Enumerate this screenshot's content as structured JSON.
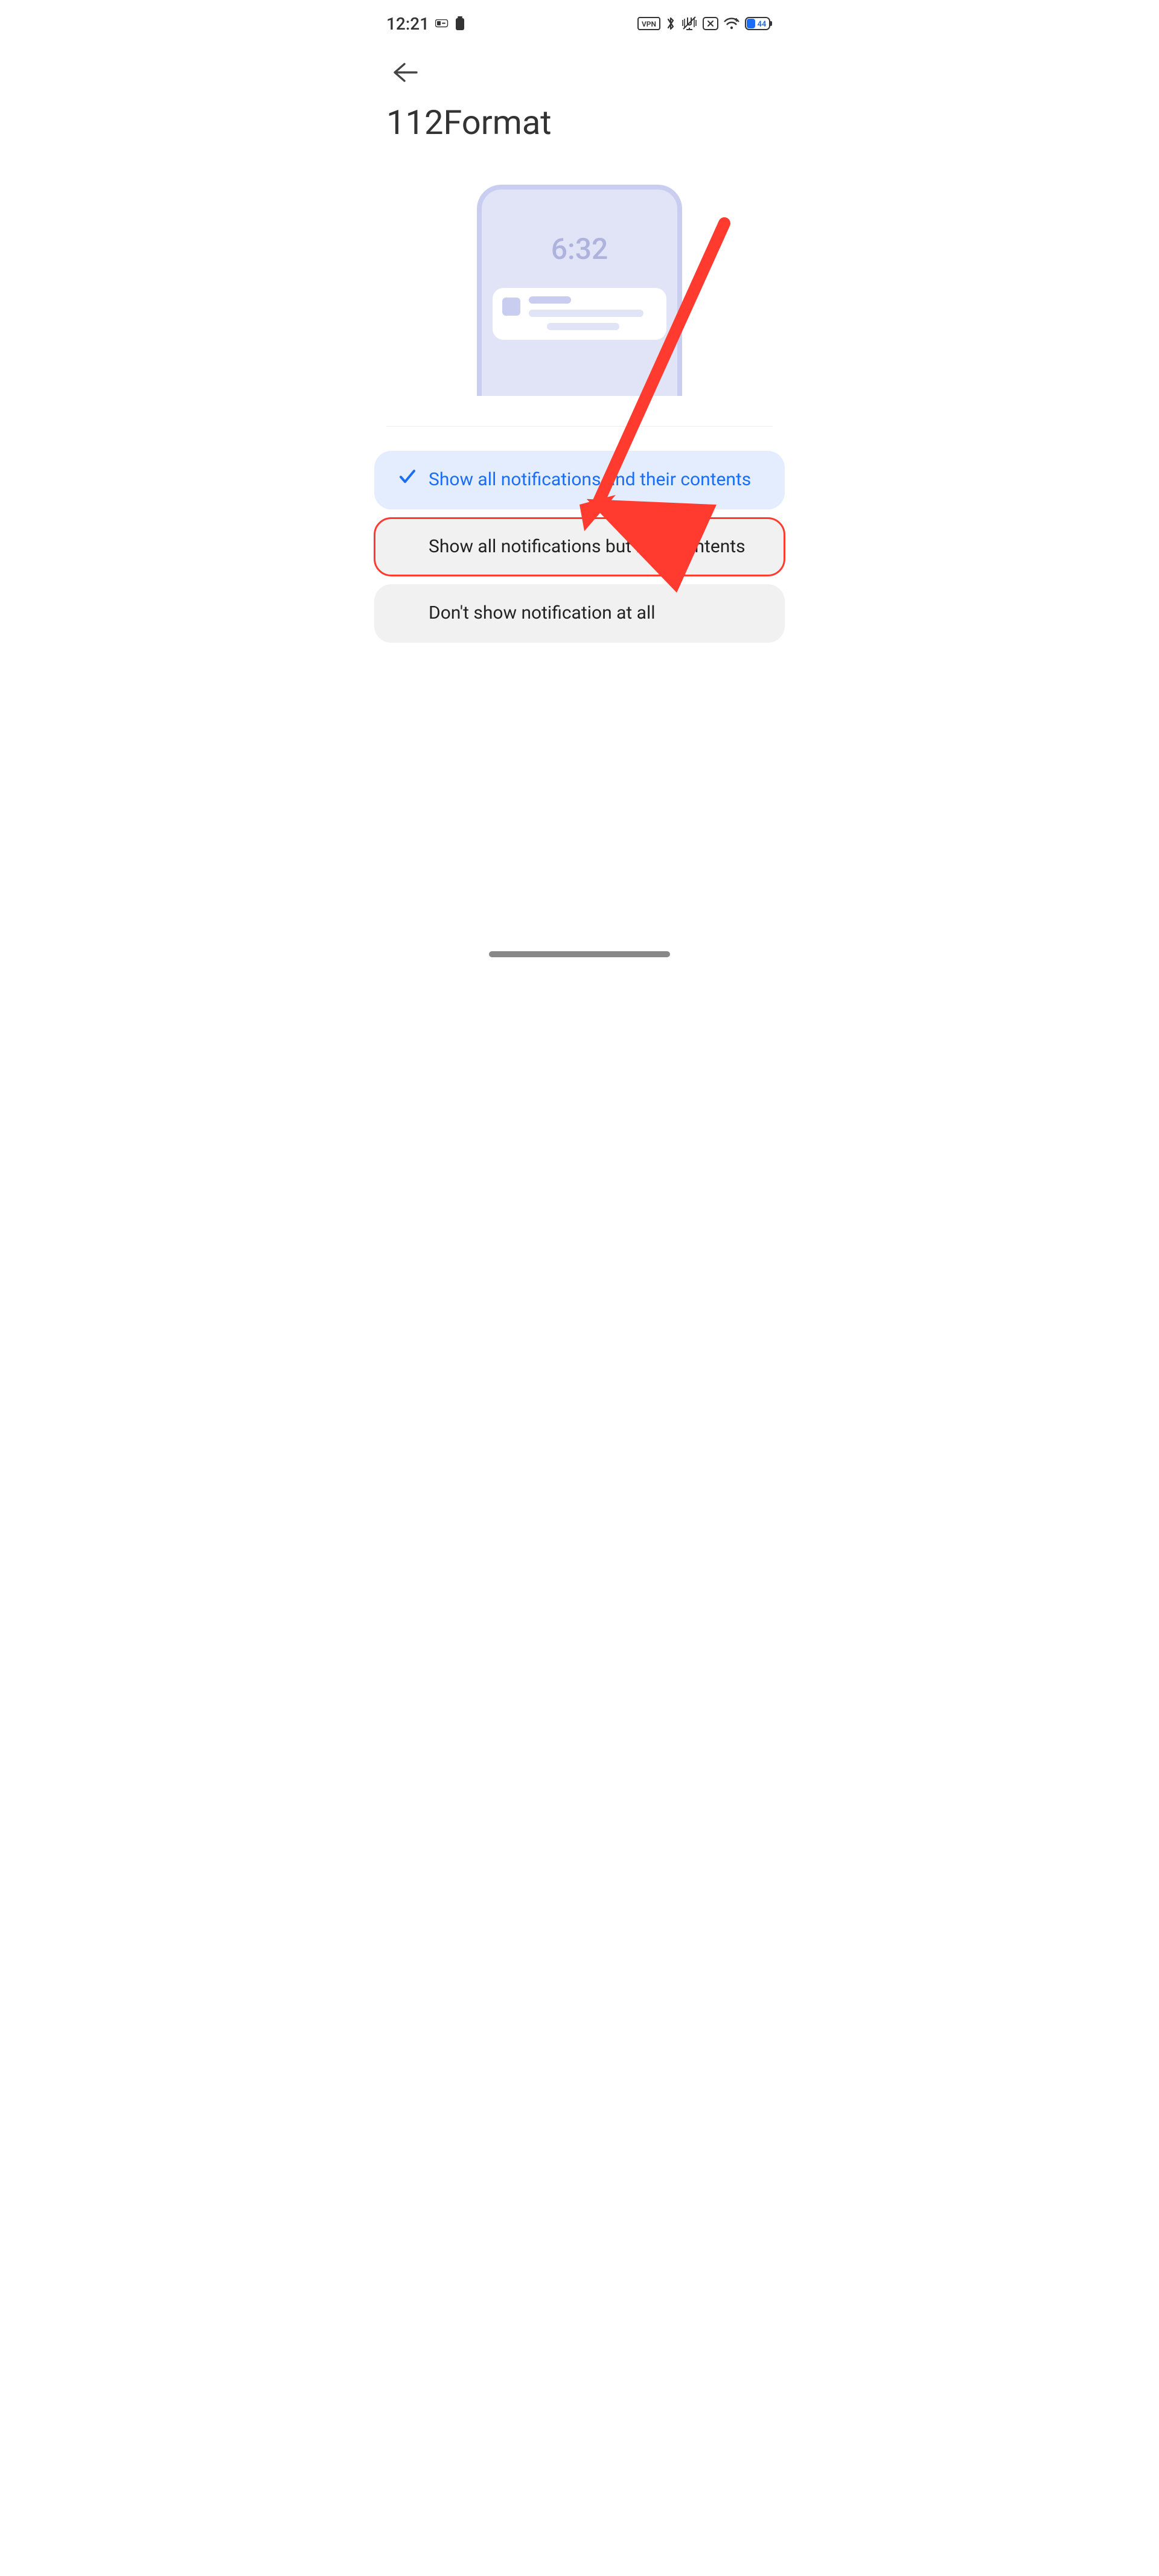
{
  "status": {
    "time": "12:21",
    "battery_percent": "44",
    "icons": {
      "vpn": "VPN",
      "bluetooth": "bluetooth",
      "vibrate": "vibrate",
      "screenshot_off": "screenshot-off",
      "wifi": "wifi",
      "battery": "battery"
    }
  },
  "header": {
    "title": "112Format"
  },
  "preview": {
    "lock_time": "6:32"
  },
  "options": [
    {
      "label": "Show all notifications and their contents",
      "selected": true,
      "highlighted": false
    },
    {
      "label": "Show all notifications but hide contents",
      "selected": false,
      "highlighted": true
    },
    {
      "label": "Don't show notification at all",
      "selected": false,
      "highlighted": false
    }
  ],
  "annotation": {
    "arrow_color": "#ff3b30"
  }
}
